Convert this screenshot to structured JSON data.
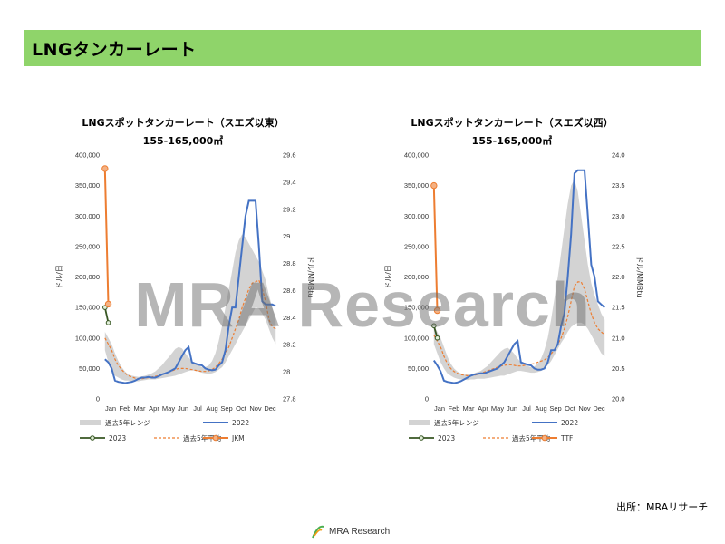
{
  "header": {
    "title": "LNGタンカーレート",
    "bg": "#8fd46a"
  },
  "watermark": "MRA Research",
  "source": "出所：MRAリサーチ",
  "footer": {
    "logo_text": "MRA Research"
  },
  "colors": {
    "band": "#d3d3d3",
    "y2022": "#4472c4",
    "y2023": "#375623",
    "avg": "#ed7d31",
    "index": "#ed7d31"
  },
  "chart_data": [
    {
      "type": "line",
      "title": "LNGスポットタンカーレート（スエズ以東）",
      "subtitle": "155-165,000㎥",
      "ylabel": "ドル/日",
      "y2label": "ドル/MMBtu",
      "categories": [
        "Jan",
        "Feb",
        "Mar",
        "Apr",
        "May",
        "Jun",
        "Jul",
        "Aug",
        "Sep",
        "Oct",
        "Nov",
        "Dec"
      ],
      "ylim": [
        0,
        400000
      ],
      "yticks": [
        "0",
        "50,000",
        "100,000",
        "150,000",
        "200,000",
        "250,000",
        "300,000",
        "350,000",
        "400,000"
      ],
      "y2lim": [
        27.8,
        29.6
      ],
      "y2ticks": [
        "27.8",
        "28",
        "28.2",
        "28.4",
        "28.6",
        "28.8",
        "29",
        "29.2",
        "29.4",
        "29.6"
      ],
      "series": [
        {
          "name": "過去5年レンジ",
          "kind": "band",
          "weeks": 52,
          "low": [
            80000,
            60000,
            45000,
            38000,
            35000,
            32000,
            30000,
            30000,
            29000,
            29000,
            29000,
            30000,
            31000,
            32000,
            32000,
            32000,
            33000,
            34000,
            35000,
            36000,
            37000,
            38000,
            40000,
            42000,
            44000,
            46000,
            47000,
            46000,
            45000,
            43000,
            42000,
            41000,
            42000,
            44000,
            48000,
            52000,
            60000,
            70000,
            80000,
            90000,
            100000,
            110000,
            120000,
            130000,
            140000,
            150000,
            148000,
            140000,
            130000,
            115000,
            100000,
            90000
          ],
          "high": [
            110000,
            100000,
            90000,
            75000,
            62000,
            52000,
            45000,
            40000,
            38000,
            37000,
            36000,
            37000,
            38000,
            40000,
            42000,
            45000,
            50000,
            55000,
            62000,
            68000,
            75000,
            82000,
            85000,
            83000,
            75000,
            68000,
            62000,
            58000,
            55000,
            52000,
            52000,
            55000,
            62000,
            75000,
            95000,
            120000,
            150000,
            180000,
            210000,
            240000,
            260000,
            270000,
            265000,
            255000,
            245000,
            235000,
            225000,
            210000,
            195000,
            170000,
            150000,
            130000
          ]
        },
        {
          "name": "2022",
          "kind": "line",
          "weeks": 52,
          "values": [
            65000,
            60000,
            50000,
            30000,
            28000,
            27000,
            26000,
            27000,
            28000,
            30000,
            33000,
            35000,
            35000,
            36000,
            35000,
            35000,
            37000,
            40000,
            42000,
            44000,
            47000,
            50000,
            60000,
            70000,
            80000,
            85000,
            60000,
            58000,
            56000,
            55000,
            50000,
            48000,
            47000,
            48000,
            55000,
            60000,
            80000,
            120000,
            150000,
            150000,
            200000,
            250000,
            300000,
            325000,
            325000,
            325000,
            250000,
            160000,
            155000,
            155000,
            155000,
            152000
          ]
        },
        {
          "name": "2023",
          "kind": "line",
          "weeks": 52,
          "values": [
            150000,
            125000
          ]
        },
        {
          "name": "過去5年平均",
          "kind": "dashed",
          "weeks": 52,
          "values": [
            100000,
            90000,
            80000,
            65000,
            55000,
            48000,
            42000,
            38000,
            36000,
            34000,
            33000,
            33000,
            34000,
            35000,
            36000,
            37000,
            38000,
            40000,
            42000,
            44000,
            46000,
            48000,
            50000,
            50000,
            50000,
            49000,
            48000,
            47000,
            46000,
            45000,
            45000,
            46000,
            48000,
            52000,
            58000,
            65000,
            75000,
            85000,
            100000,
            115000,
            130000,
            150000,
            165000,
            180000,
            190000,
            192000,
            195000,
            180000,
            160000,
            130000,
            118000,
            115000
          ]
        },
        {
          "name": "JKM",
          "kind": "line2",
          "weeks": 52,
          "values": [
            29.5,
            28.5
          ]
        }
      ]
    },
    {
      "type": "line",
      "title": "LNGスポットタンカーレート（スエズ以西）",
      "subtitle": "155-165,000㎥",
      "ylabel": "ドル/日",
      "y2label": "ドル/MMBtu",
      "categories": [
        "Jan",
        "Feb",
        "Mar",
        "Apr",
        "May",
        "Jun",
        "Jul",
        "Aug",
        "Sep",
        "Oct",
        "Nov",
        "Dec"
      ],
      "ylim": [
        0,
        400000
      ],
      "yticks": [
        "0",
        "50,000",
        "100,000",
        "150,000",
        "200,000",
        "250,000",
        "300,000",
        "350,000",
        "400,000"
      ],
      "y2lim": [
        20.0,
        24.0
      ],
      "y2ticks": [
        "20.0",
        "20.5",
        "21.0",
        "21.5",
        "22.0",
        "22.5",
        "23.0",
        "23.5",
        "24.0"
      ],
      "series": [
        {
          "name": "過去5年レンジ",
          "kind": "band",
          "weeks": 52,
          "low": [
            90000,
            75000,
            60000,
            50000,
            42000,
            38000,
            35000,
            33000,
            32000,
            32000,
            31000,
            32000,
            32000,
            33000,
            33000,
            33000,
            34000,
            35000,
            36000,
            37000,
            38000,
            38000,
            40000,
            42000,
            44000,
            46000,
            46000,
            45000,
            44000,
            43000,
            43000,
            44000,
            46000,
            50000,
            55000,
            62000,
            72000,
            82000,
            92000,
            100000,
            110000,
            118000,
            122000,
            125000,
            125000,
            122000,
            115000,
            105000,
            95000,
            85000,
            75000,
            70000
          ],
          "high": [
            120000,
            110000,
            100000,
            85000,
            70000,
            58000,
            50000,
            45000,
            42000,
            40000,
            40000,
            40000,
            42000,
            44000,
            46000,
            50000,
            54000,
            60000,
            66000,
            72000,
            78000,
            82000,
            84000,
            80000,
            74000,
            66000,
            60000,
            56000,
            54000,
            52000,
            53000,
            58000,
            66000,
            80000,
            100000,
            130000,
            165000,
            200000,
            240000,
            280000,
            320000,
            350000,
            360000,
            340000,
            300000,
            260000,
            220000,
            190000,
            170000,
            155000,
            140000,
            130000
          ]
        },
        {
          "name": "2022",
          "kind": "line",
          "weeks": 52,
          "values": [
            63000,
            55000,
            45000,
            30000,
            28000,
            27000,
            26000,
            27000,
            29000,
            32000,
            35000,
            38000,
            40000,
            41000,
            42000,
            42000,
            44000,
            46000,
            48000,
            50000,
            55000,
            60000,
            70000,
            80000,
            90000,
            95000,
            60000,
            58000,
            56000,
            55000,
            50000,
            48000,
            48000,
            50000,
            60000,
            80000,
            80000,
            90000,
            120000,
            140000,
            200000,
            270000,
            370000,
            375000,
            375000,
            375000,
            300000,
            220000,
            200000,
            160000,
            155000,
            150000
          ]
        },
        {
          "name": "2023",
          "kind": "line",
          "weeks": 52,
          "values": [
            120000,
            100000
          ]
        },
        {
          "name": "過去5年平均",
          "kind": "dashed",
          "weeks": 52,
          "values": [
            105000,
            95000,
            85000,
            70000,
            58000,
            50000,
            45000,
            42000,
            40000,
            39000,
            38000,
            38000,
            39000,
            40000,
            42000,
            44000,
            46000,
            48000,
            50000,
            52000,
            54000,
            55000,
            56000,
            56000,
            55000,
            54000,
            54000,
            55000,
            56000,
            57000,
            58000,
            60000,
            62000,
            64000,
            68000,
            74000,
            80000,
            90000,
            100000,
            115000,
            135000,
            160000,
            185000,
            192000,
            192000,
            180000,
            160000,
            140000,
            125000,
            115000,
            110000,
            105000
          ]
        },
        {
          "name": "TTF",
          "kind": "line2",
          "weeks": 52,
          "values": [
            23.5,
            21.45
          ]
        }
      ]
    }
  ]
}
